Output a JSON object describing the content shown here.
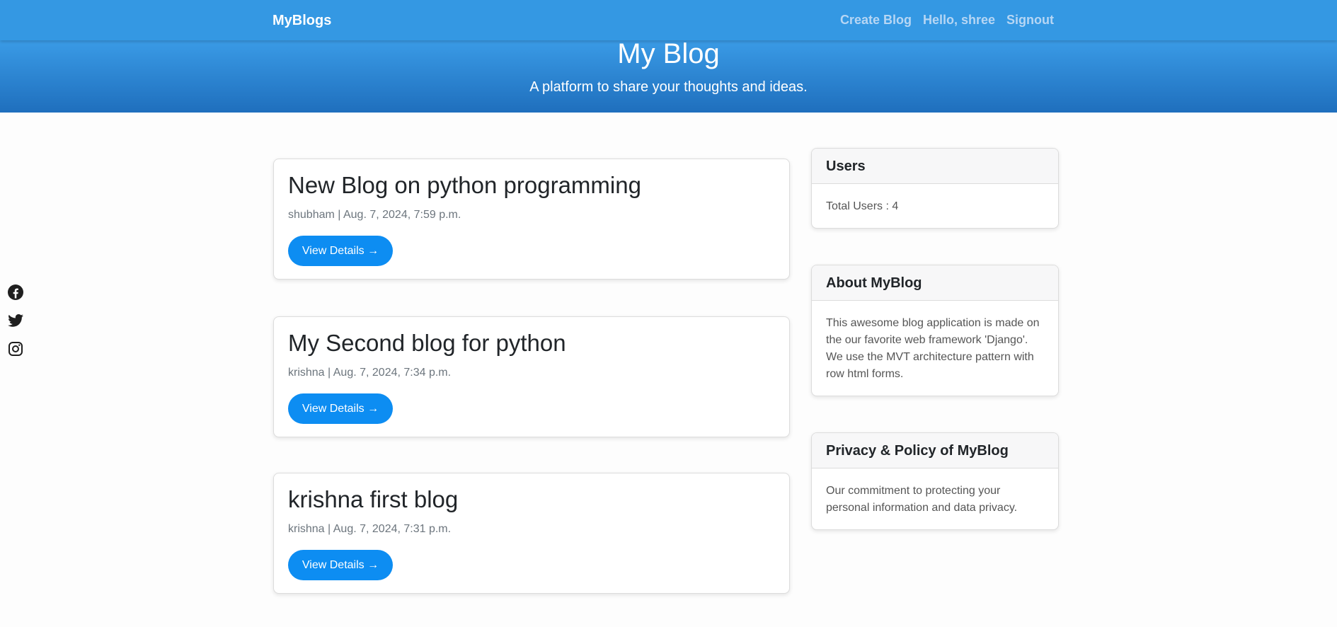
{
  "navbar": {
    "brand": "MyBlogs",
    "links": [
      "Create Blog",
      "Hello, shree",
      "Signout"
    ]
  },
  "hero": {
    "title": "My Blog",
    "subtitle": "A platform to share your thoughts and ideas."
  },
  "social": {
    "icons": [
      "facebook-icon",
      "twitter-icon",
      "instagram-icon"
    ]
  },
  "posts": [
    {
      "title": "New Blog on python programming",
      "meta": "shubham | Aug. 7, 2024, 7:59 p.m.",
      "button": "View Details →"
    },
    {
      "title": "My Second blog for python",
      "meta": "krishna | Aug. 7, 2024, 7:34 p.m.",
      "button": "View Details →"
    },
    {
      "title": "krishna first blog",
      "meta": "krishna | Aug. 7, 2024, 7:31 p.m.",
      "button": "View Details →"
    }
  ],
  "sidebar": {
    "users": {
      "title": "Users",
      "body": "Total Users : 4"
    },
    "about": {
      "title": "About MyBlog",
      "body": "This awesome blog application is made on the our favorite web framework 'Django'. We use the MVT architecture pattern with row html forms."
    },
    "privacy": {
      "title": "Privacy & Policy of MyBlog",
      "body": "Our commitment to protecting your personal information and data privacy."
    }
  },
  "colors": {
    "navbar": "#3498e3",
    "hero_top": "#3a9be6",
    "hero_bottom": "#1f6fbd",
    "button": "#0d8df2",
    "nav_link": "#b6d6f4"
  }
}
